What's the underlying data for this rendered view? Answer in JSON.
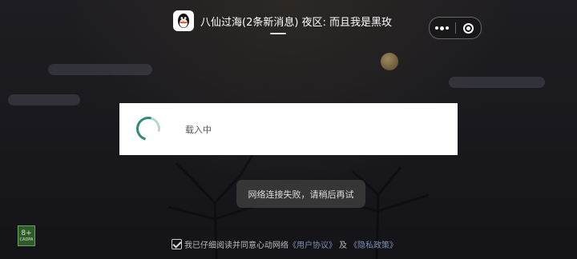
{
  "header": {
    "title": "八仙过海(2条新消息) 夜区: 而且我是黑玫",
    "app_icon": "qq-penguin-icon"
  },
  "capsule": {
    "more_icon": "more-dots-icon",
    "close_icon": "close-miniprogram-icon"
  },
  "loading": {
    "text": "载入中"
  },
  "toast": {
    "text": "网络连接失败，请稍后再试"
  },
  "age_badge": {
    "rating": "8+",
    "caption": "CADPA"
  },
  "agreement": {
    "prefix": "我已仔细阅读并同意心动网络",
    "user_agreement": "《用户协议》",
    "and": "及",
    "privacy_policy": "《隐私政策》",
    "checked": true
  },
  "colors": {
    "spinner": "#2e8b76",
    "link": "#7d8fb3",
    "card": "#ffffff",
    "toast_bg": "#3c3c3c"
  }
}
